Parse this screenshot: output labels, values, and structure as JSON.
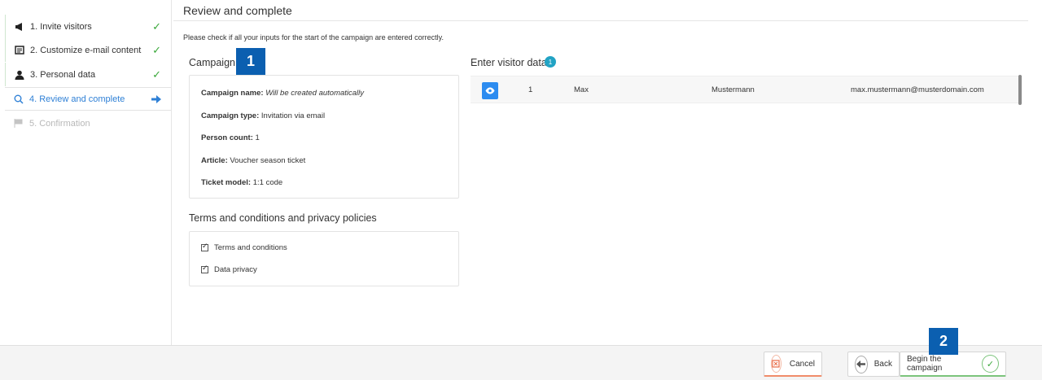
{
  "steps": [
    {
      "label": "1. Invite visitors",
      "icon": "megaphone-icon",
      "status": "complete"
    },
    {
      "label": "2. Customize e-mail content",
      "icon": "email-template-icon",
      "status": "complete"
    },
    {
      "label": "3. Personal data",
      "icon": "person-icon",
      "status": "complete"
    },
    {
      "label": "4. Review and complete",
      "icon": "search-icon",
      "status": "current"
    },
    {
      "label": "5. Confirmation",
      "icon": "flag-icon",
      "status": "pending"
    }
  ],
  "page": {
    "title": "Review and complete",
    "intro": "Please check if all your inputs for the start of the campaign are entered correctly."
  },
  "campaign": {
    "title": "Campaign",
    "callout": "1",
    "fields": [
      {
        "label": "Campaign name:",
        "value": "Will be created automatically"
      },
      {
        "label": "Campaign type:",
        "value": "Invitation via email"
      },
      {
        "label": "Person count:",
        "value": "1"
      },
      {
        "label": "Article:",
        "value": "Voucher season ticket"
      },
      {
        "label": "Ticket model:",
        "value": "1:1 code"
      }
    ]
  },
  "terms": {
    "title": "Terms and conditions and privacy policies",
    "items": [
      "Terms and conditions",
      "Data privacy"
    ]
  },
  "visitors": {
    "title": "Enter visitor data",
    "count": "1",
    "rows": [
      {
        "index": "1",
        "first_name": "Max",
        "last_name": "Mustermann",
        "email": "max.mustermann@musterdomain.com"
      }
    ]
  },
  "footer": {
    "cancel_label": "Cancel",
    "back_label": "Back",
    "begin_label": "Begin the campaign",
    "callout": "2"
  },
  "colors": {
    "accent": "#2f80d6",
    "callout": "#0b5fb0",
    "success": "#3aa83a",
    "cancel": "#e86b45"
  }
}
